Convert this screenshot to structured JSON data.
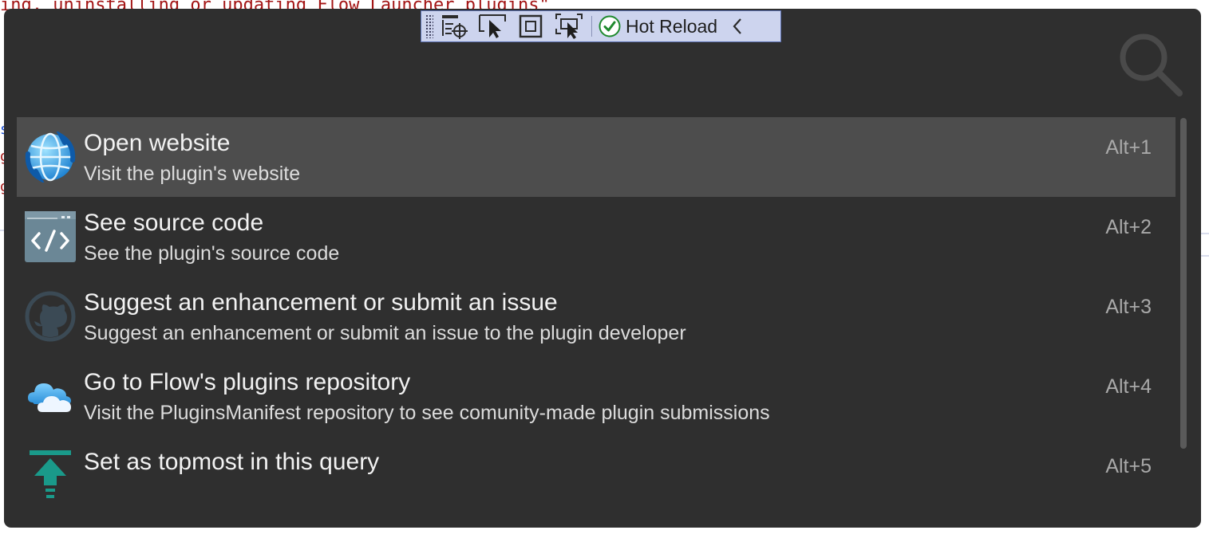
{
  "background_code": {
    "line": "ing, uninstalling or updating Flow Launcher plugins\""
  },
  "vs_toolbar": {
    "hot_reload_label": "Hot Reload"
  },
  "results": [
    {
      "title": "Open website",
      "subtitle": "Visit the plugin's website",
      "shortcut": "Alt+1",
      "icon": "globe-icon",
      "selected": true
    },
    {
      "title": "See source code",
      "subtitle": "See the plugin's source code",
      "shortcut": "Alt+2",
      "icon": "source-code-icon",
      "selected": false
    },
    {
      "title": "Suggest an enhancement or submit an issue",
      "subtitle": "Suggest an enhancement or submit an issue to the plugin developer",
      "shortcut": "Alt+3",
      "icon": "github-icon",
      "selected": false
    },
    {
      "title": "Go to Flow's plugins repository",
      "subtitle": "Visit the PluginsManifest repository to see comunity-made plugin submissions",
      "shortcut": "Alt+4",
      "icon": "cloud-icon",
      "selected": false
    },
    {
      "title": "Set as topmost in this query",
      "subtitle": "",
      "shortcut": "Alt+5",
      "icon": "topmost-icon",
      "selected": false
    }
  ],
  "colors": {
    "window_bg": "#2f2f2f",
    "selected_row_bg": "#4d4d4d",
    "toolbar_bg": "#cdd4ee",
    "topmost_accent": "#1a9a8a"
  }
}
